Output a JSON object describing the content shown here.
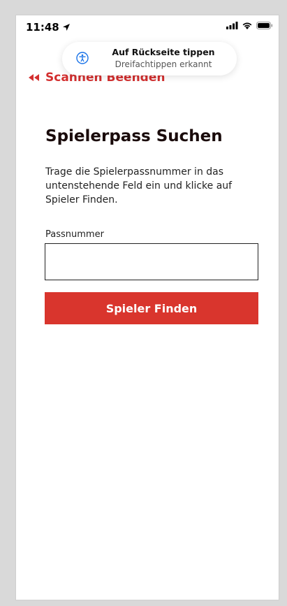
{
  "status_bar": {
    "time": "11:48"
  },
  "banner": {
    "title": "Auf Rückseite tippen",
    "subtitle": "Dreifachtippen erkannt",
    "icon": "accessibility-icon"
  },
  "nav": {
    "back_label": "Scannen Beenden",
    "back_icon": "double-chevron-left-icon"
  },
  "main": {
    "title": "Spielerpass Suchen",
    "description": "Trage die Spielerpassnummer in das untenstehende Feld ein und klicke auf Spieler Finden.",
    "field_label": "Passnummer",
    "field_value": "",
    "field_placeholder": "",
    "button_label": "Spieler Finden"
  },
  "colors": {
    "accent": "#d9352d",
    "back_link": "#d32f2f",
    "title": "#1a0b0b"
  }
}
